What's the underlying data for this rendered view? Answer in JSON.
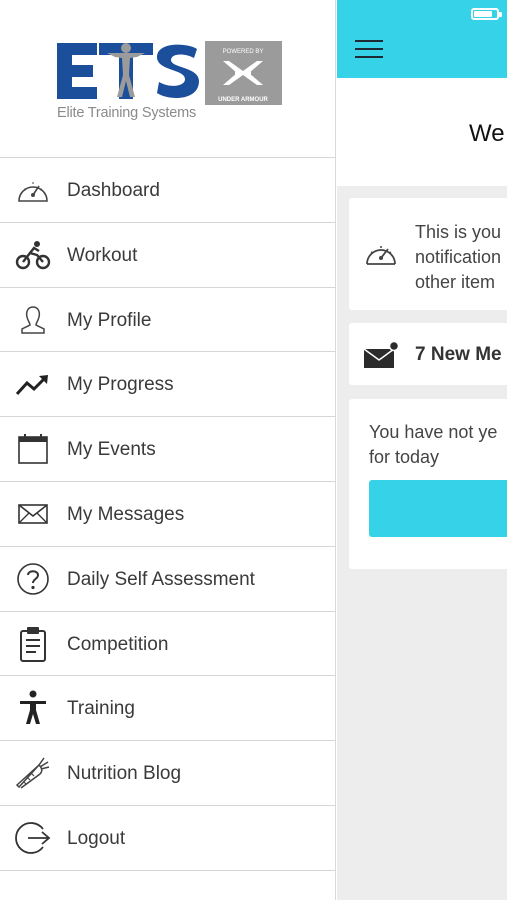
{
  "drawer": {
    "logo": {
      "brand": "ETS",
      "tagline": "Elite Training Systems",
      "powered_by": "POWERED BY",
      "partner": "UNDER ARMOUR"
    },
    "menu": [
      {
        "label": "Dashboard",
        "icon": "speedometer-icon"
      },
      {
        "label": "Workout",
        "icon": "cyclist-icon"
      },
      {
        "label": "My Profile",
        "icon": "person-icon"
      },
      {
        "label": "My Progress",
        "icon": "trending-up-icon"
      },
      {
        "label": "My Events",
        "icon": "calendar-icon"
      },
      {
        "label": "My Messages",
        "icon": "envelope-icon"
      },
      {
        "label": "Daily Self Assessment",
        "icon": "question-icon"
      },
      {
        "label": "Competition",
        "icon": "clipboard-icon"
      },
      {
        "label": "Training",
        "icon": "figure-icon"
      },
      {
        "label": "Nutrition Blog",
        "icon": "carrot-icon"
      },
      {
        "label": "Logout",
        "icon": "logout-icon"
      }
    ]
  },
  "main": {
    "welcome": "We",
    "notification": {
      "line1": "This is you",
      "line2": "notification",
      "line3": "other item"
    },
    "messages": "7 New Me",
    "workout": {
      "line1": "You have not ye",
      "line2": "for today"
    }
  },
  "colors": {
    "accent": "#35d2e8",
    "logo_blue": "#1b4f9c",
    "badge_gray": "#9b9b9b"
  }
}
